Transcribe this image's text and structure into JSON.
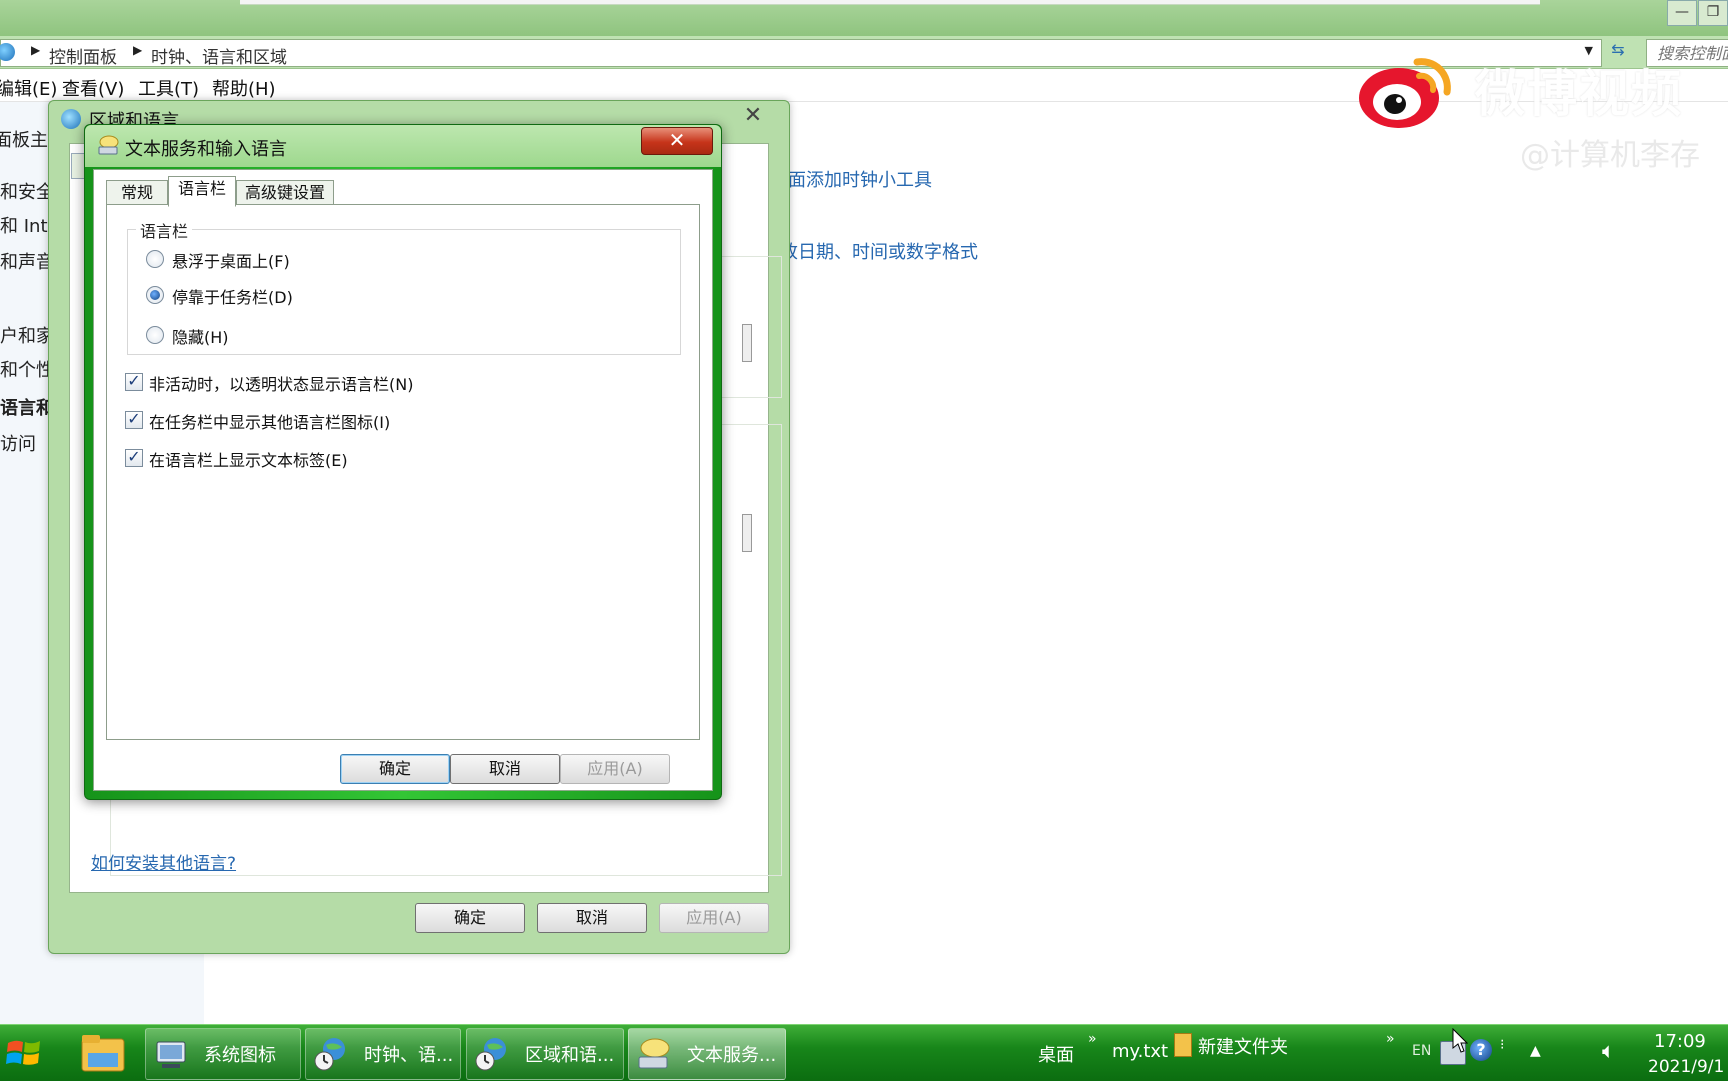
{
  "explorer": {
    "breadcrumb": [
      "控制面板",
      "时钟、语言和区域"
    ],
    "search_placeholder": "搜索控制面",
    "menu": [
      "编辑(E)",
      "查看(V)",
      "工具(T)",
      "帮助(H)"
    ],
    "left_nav": [
      "面板主页",
      "和安全",
      "和 Internet",
      "和声音",
      "户和家庭",
      "和个性化",
      "语言和",
      "访问"
    ],
    "right_links": [
      "面添加时钟小工具",
      "改日期、时间或数字格式"
    ]
  },
  "watermark": {
    "text": "微博视频",
    "sub": "@计算机李存"
  },
  "region_dialog": {
    "title": "区域和语言",
    "link": "如何安装其他语言?",
    "buttons": {
      "ok": "确定",
      "cancel": "取消",
      "apply": "应用(A)"
    }
  },
  "text_services_dialog": {
    "title": "文本服务和输入语言",
    "close": "✕",
    "tabs": [
      "常规",
      "语言栏",
      "高级键设置"
    ],
    "selected_tab": "语言栏",
    "group_title": "语言栏",
    "radios": [
      {
        "label": "悬浮于桌面上(F)",
        "checked": false
      },
      {
        "label": "停靠于任务栏(D)",
        "checked": true
      },
      {
        "label": "隐藏(H)",
        "checked": false
      }
    ],
    "checkboxes": [
      {
        "label": "非活动时，以透明状态显示语言栏(N)",
        "checked": true
      },
      {
        "label": "在任务栏中显示其他语言栏图标(I)",
        "checked": true
      },
      {
        "label": "在语言栏上显示文本标签(E)",
        "checked": true
      }
    ],
    "buttons": {
      "ok": "确定",
      "cancel": "取消",
      "apply": "应用(A)"
    }
  },
  "taskbar": {
    "buttons": [
      {
        "label": "系统图标",
        "active": false
      },
      {
        "label": "时钟、语...",
        "active": false
      },
      {
        "label": "区域和语...",
        "active": false
      },
      {
        "label": "文本服务...",
        "active": true
      }
    ],
    "toolbar_items": [
      "桌面",
      "my.txt",
      "新建文件夹"
    ],
    "lang": "EN",
    "time": "17:09",
    "date": "2021/9/1"
  }
}
